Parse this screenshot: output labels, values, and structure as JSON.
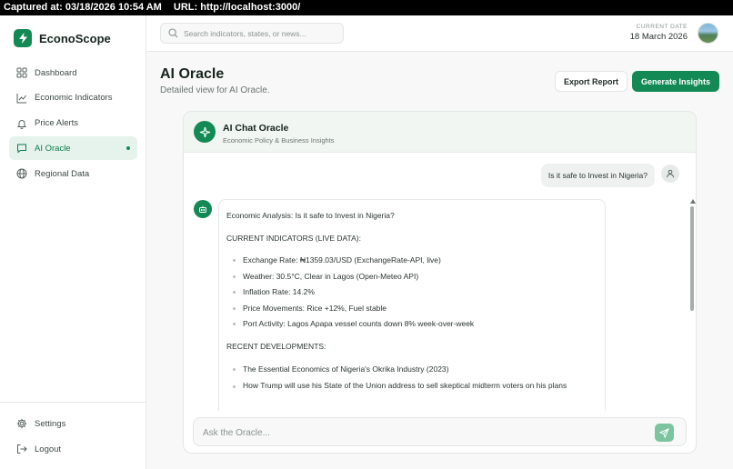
{
  "capture": {
    "captured_at": "Captured at: 03/18/2026 10:54 AM",
    "url": "URL: http://localhost:3000/"
  },
  "brand": {
    "name": "EconoScope",
    "icon": "lightning-icon",
    "color": "#138a55"
  },
  "sidebar": {
    "items": [
      {
        "label": "Dashboard",
        "icon": "grid-icon",
        "active": false
      },
      {
        "label": "Economic Indicators",
        "icon": "line-chart-icon",
        "active": false
      },
      {
        "label": "Price Alerts",
        "icon": "bell-icon",
        "active": false
      },
      {
        "label": "AI Oracle",
        "icon": "chat-icon",
        "active": true
      },
      {
        "label": "Regional Data",
        "icon": "globe-icon",
        "active": false
      }
    ],
    "bottom": [
      {
        "label": "Settings",
        "icon": "gear-icon"
      },
      {
        "label": "Logout",
        "icon": "logout-icon"
      }
    ]
  },
  "topbar": {
    "search_placeholder": "Search indicators, states, or news...",
    "date_label": "CURRENT DATE",
    "date_value": "18 March 2026"
  },
  "page": {
    "title": "AI Oracle",
    "subtitle": "Detailed view for AI Oracle.",
    "export_label": "Export Report",
    "generate_label": "Generate Insights"
  },
  "chat": {
    "title": "AI Chat Oracle",
    "subtitle": "Economic Policy & Business Insights",
    "user_message": "Is it safe to Invest in Nigeria?",
    "bot": {
      "heading": "Economic Analysis: Is it safe to Invest in Nigeria?",
      "section1": "CURRENT INDICATORS (LIVE DATA):",
      "indicators": [
        "Exchange Rate: ₦1359.03/USD (ExchangeRate-API, live)",
        "Weather: 30.5°C, Clear in Lagos (Open-Meteo API)",
        "Inflation Rate: 14.2%",
        "Price Movements: Rice +12%, Fuel stable",
        "Port Activity: Lagos Apapa vessel counts down 8% week-over-week"
      ],
      "section2": "RECENT DEVELOPMENTS:",
      "developments": [
        "The Essential Economics of Nigeria's Okrika Industry (2023)",
        "How Trump will use his State of the Union address to sell skeptical midterm voters on his plans"
      ]
    },
    "input_placeholder": "Ask the Oracle..."
  }
}
